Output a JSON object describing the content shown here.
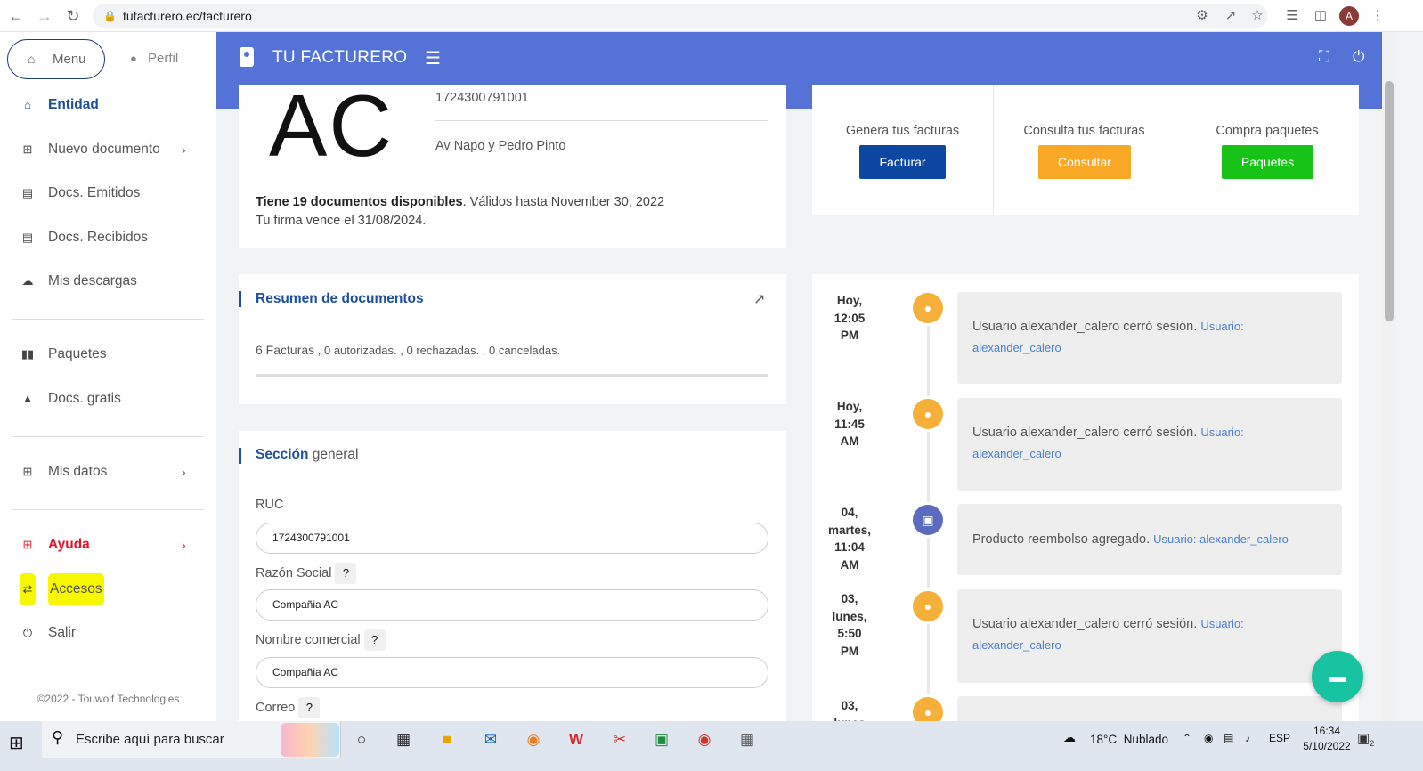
{
  "browser": {
    "url": "tufacturero.ec/facturero",
    "avatar_letter": "A"
  },
  "sidebar": {
    "menu_label": "Menu",
    "perfil_label": "Perfil",
    "items": [
      {
        "label": "Entidad"
      },
      {
        "label": "Nuevo documento"
      },
      {
        "label": "Docs. Emitidos"
      },
      {
        "label": "Docs. Recibidos"
      },
      {
        "label": "Mis descargas"
      },
      {
        "label": "Paquetes"
      },
      {
        "label": "Docs. gratis"
      },
      {
        "label": "Mis datos"
      },
      {
        "label": "Ayuda"
      },
      {
        "label": "Accesos"
      },
      {
        "label": "Salir"
      }
    ],
    "copyright": "©2022 - Touwolf Technologies"
  },
  "header": {
    "title": "TU FACTURERO",
    "accent_color": "#5572d6"
  },
  "profile": {
    "logo_text": "AC",
    "ruc": "1724300791001",
    "address": "Av Napo y Pedro Pinto",
    "docs_bold": "Tiene 19 documentos disponibles",
    "docs_rest": ". Válidos hasta November 30, 2022",
    "firma": "Tu firma vence el 31/08/2024."
  },
  "actions": [
    {
      "label": "Genera tus facturas",
      "button": "Facturar",
      "color": "#0d47a1"
    },
    {
      "label": "Consulta tus facturas",
      "button": "Consultar",
      "color": "#f9a825"
    },
    {
      "label": "Compra paquetes",
      "button": "Paquetes",
      "color": "#17c317"
    }
  ],
  "resumen": {
    "title": "Resumen de documentos",
    "facturas": "6 Facturas",
    "detail": " , 0 autorizadas. , 0 rechazadas. , 0 canceladas."
  },
  "general": {
    "title_bold": "Sección",
    "title_rest": " general",
    "fields": [
      {
        "label": "RUC",
        "value": "1724300791001"
      },
      {
        "label": "Razón Social",
        "value": "Compañia AC"
      },
      {
        "label": "Nombre comercial",
        "value": "Compañia AC"
      },
      {
        "label": "Correo",
        "value": ""
      }
    ]
  },
  "activity": [
    {
      "time": [
        "Hoy,",
        "12:05",
        "PM"
      ],
      "icon": "user-icon",
      "text": "Usuario alexander_calero cerró sesión.",
      "user": "Usuario: alexander_calero"
    },
    {
      "time": [
        "Hoy,",
        "11:45",
        "AM"
      ],
      "icon": "user-icon",
      "text": "Usuario alexander_calero cerró sesión.",
      "user": "Usuario: alexander_calero"
    },
    {
      "time": [
        "04,",
        "martes,",
        "11:04",
        "AM"
      ],
      "icon": "save-icon",
      "text": "Producto reembolso agregado.",
      "user": "Usuario: alexander_calero"
    },
    {
      "time": [
        "03,",
        "lunes,",
        "5:50",
        "PM"
      ],
      "icon": "user-icon",
      "text": "Usuario alexander_calero cerró sesión.",
      "user": "Usuario: alexander_calero"
    },
    {
      "time": [
        "03,",
        "lunes"
      ],
      "icon": "user-icon",
      "text": "",
      "user": ""
    }
  ],
  "taskbar": {
    "search_placeholder": "Escribe aquí para buscar",
    "temperature": "18°C",
    "weather": "Nublado",
    "lang": "ESP",
    "time": "16:34",
    "date": "5/10/2022",
    "notifications": "2"
  }
}
